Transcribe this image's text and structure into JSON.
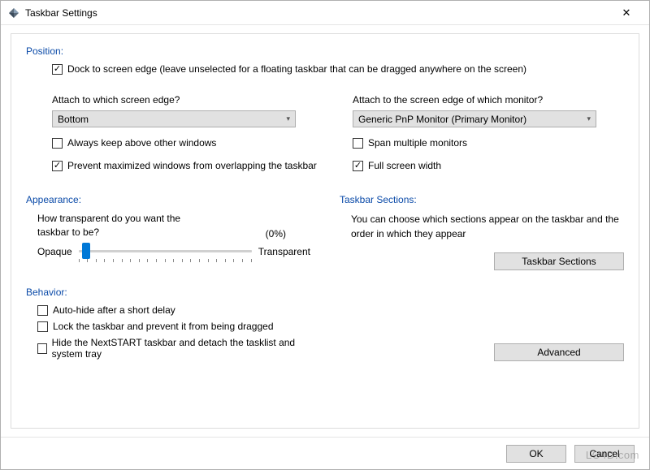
{
  "window": {
    "title": "Taskbar Settings",
    "close": "✕"
  },
  "position": {
    "section": "Position:",
    "dock_label": "Dock to screen edge (leave unselected for a floating taskbar that can be dragged anywhere on the screen)",
    "dock_checked": true,
    "edge_q": "Attach to which screen edge?",
    "edge_value": "Bottom",
    "monitor_q": "Attach to the screen edge of which monitor?",
    "monitor_value": "Generic PnP Monitor (Primary Monitor)",
    "above_label": "Always keep above other windows",
    "above_checked": false,
    "span_label": "Span multiple monitors",
    "span_checked": false,
    "prevent_label": "Prevent maximized windows from overlapping the taskbar",
    "prevent_checked": true,
    "fullwidth_label": "Full screen width",
    "fullwidth_checked": true
  },
  "appearance": {
    "section": "Appearance:",
    "transparency_q": "How transparent do you want the taskbar to be?",
    "percent_label": "(0%)",
    "opaque_label": "Opaque",
    "transparent_label": "Transparent",
    "slider_value": 0
  },
  "sections": {
    "section": "Taskbar Sections:",
    "desc": "You can choose which sections appear on the taskbar and the order in which they appear",
    "button": "Taskbar Sections"
  },
  "behavior": {
    "section": "Behavior:",
    "autohide_label": "Auto-hide after a short delay",
    "autohide_checked": false,
    "lock_label": "Lock the taskbar and prevent it from being dragged",
    "lock_checked": false,
    "hide_ns_label": "Hide the NextSTART taskbar and detach the tasklist and system tray",
    "hide_ns_checked": false,
    "advanced_button": "Advanced"
  },
  "footer": {
    "ok": "OK",
    "cancel": "Cancel"
  },
  "watermark": "LO4D.com"
}
